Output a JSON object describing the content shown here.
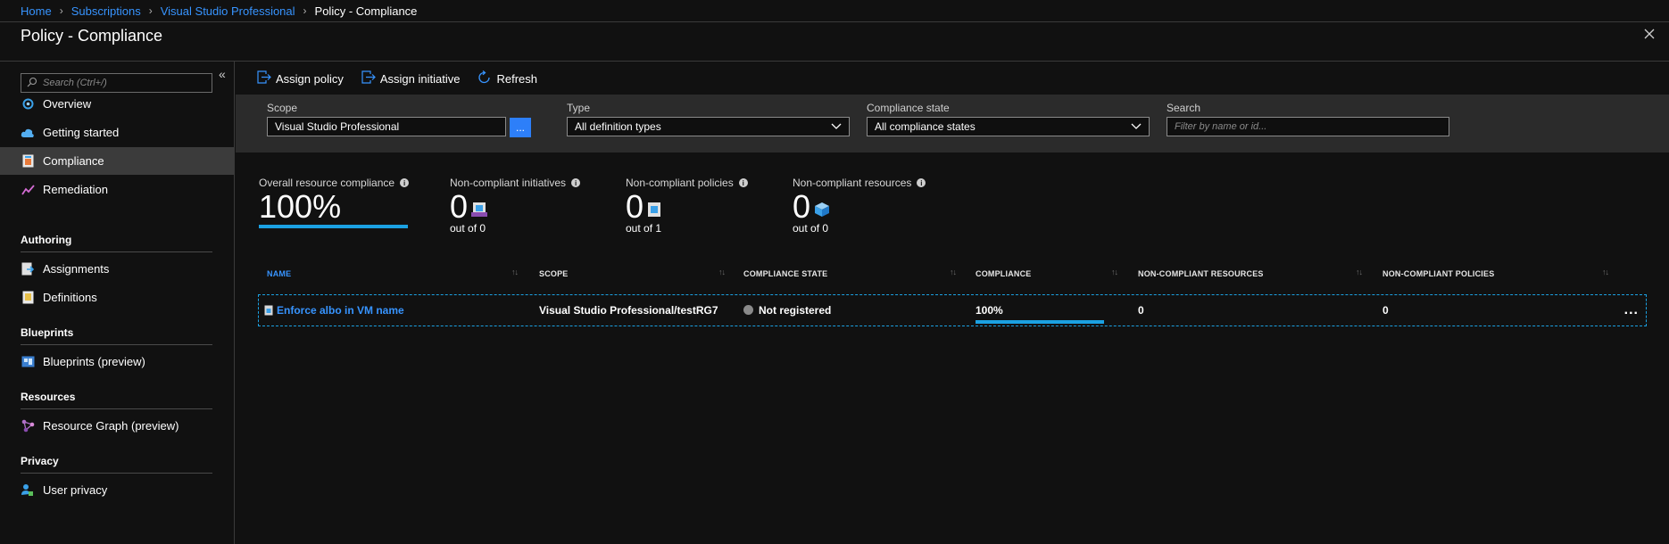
{
  "breadcrumb": {
    "items": [
      "Home",
      "Subscriptions",
      "Visual Studio Professional"
    ],
    "current": "Policy - Compliance"
  },
  "page": {
    "title": "Policy - Compliance"
  },
  "sidebar": {
    "search_placeholder": "Search (Ctrl+/)",
    "items": [
      {
        "label": "Overview",
        "icon": "overview-icon"
      },
      {
        "label": "Getting started",
        "icon": "cloud-icon"
      },
      {
        "label": "Compliance",
        "icon": "compliance-icon",
        "active": true
      },
      {
        "label": "Remediation",
        "icon": "remediation-icon"
      }
    ],
    "sections": [
      {
        "heading": "Authoring",
        "items": [
          {
            "label": "Assignments",
            "icon": "assignments-icon"
          },
          {
            "label": "Definitions",
            "icon": "definitions-icon"
          }
        ]
      },
      {
        "heading": "Blueprints",
        "items": [
          {
            "label": "Blueprints (preview)",
            "icon": "blueprints-icon"
          }
        ]
      },
      {
        "heading": "Resources",
        "items": [
          {
            "label": "Resource Graph (preview)",
            "icon": "resource-graph-icon"
          }
        ]
      },
      {
        "heading": "Privacy",
        "items": [
          {
            "label": "User privacy",
            "icon": "user-privacy-icon"
          }
        ]
      }
    ]
  },
  "toolbar": {
    "assign_policy": "Assign policy",
    "assign_initiative": "Assign initiative",
    "refresh": "Refresh"
  },
  "filters": {
    "scope": {
      "label": "Scope",
      "value": "Visual Studio Professional",
      "button": "..."
    },
    "type": {
      "label": "Type",
      "value": "All definition types"
    },
    "compliance_state": {
      "label": "Compliance state",
      "value": "All compliance states"
    },
    "search": {
      "label": "Search",
      "placeholder": "Filter by name or id..."
    }
  },
  "stats": {
    "overall": {
      "label": "Overall resource compliance",
      "value": "100%",
      "fill_percent": 100
    },
    "initiatives": {
      "label": "Non-compliant initiatives",
      "value": "0",
      "sub": "out of 0"
    },
    "policies": {
      "label": "Non-compliant policies",
      "value": "0",
      "sub": "out of 1"
    },
    "resources": {
      "label": "Non-compliant resources",
      "value": "0",
      "sub": "out of 0"
    }
  },
  "table": {
    "columns": [
      "NAME",
      "SCOPE",
      "COMPLIANCE STATE",
      "COMPLIANCE",
      "NON-COMPLIANT RESOURCES",
      "NON-COMPLIANT POLICIES"
    ],
    "rows": [
      {
        "name": "Enforce albo in VM name",
        "scope": "Visual Studio Professional/testRG7",
        "compliance_state": "Not registered",
        "compliance": "100%",
        "compliance_fill_percent": 100,
        "non_compliant_resources": "0",
        "non_compliant_policies": "0"
      }
    ],
    "more": "..."
  },
  "colors": {
    "accent": "#1ba1e2",
    "link": "#3794ff",
    "button": "#2d7ff9",
    "active_nav": "#3b3b3b"
  }
}
